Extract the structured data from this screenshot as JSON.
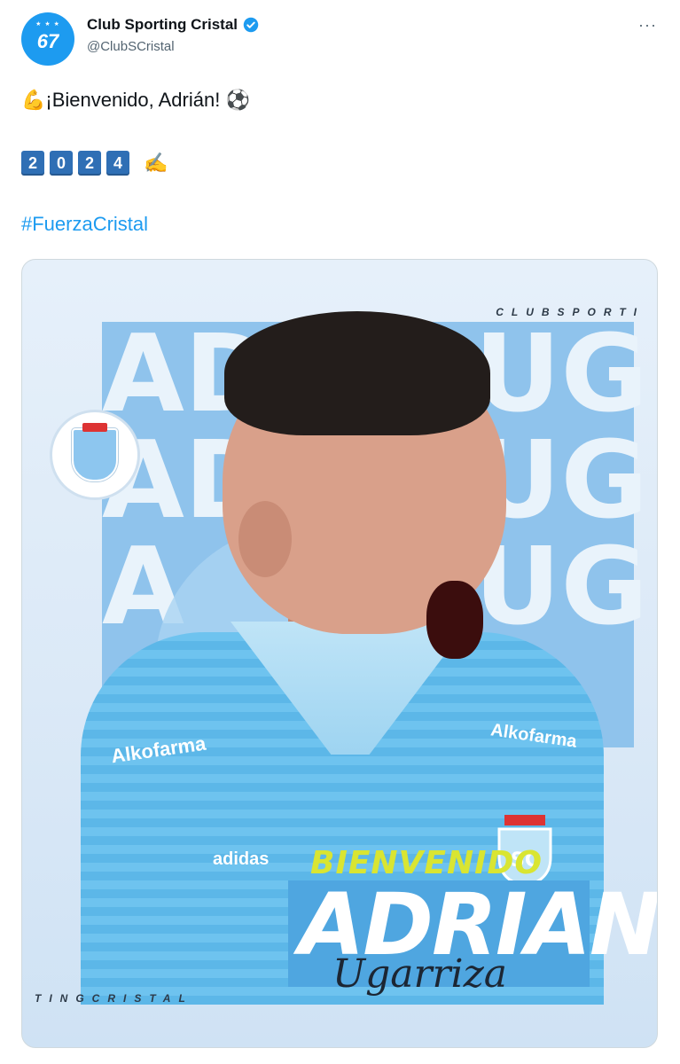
{
  "account": {
    "avatar_text": "67",
    "avatar_stars": "★ ★ ★",
    "display_name": "Club Sporting Cristal",
    "handle": "@ClubSCristal",
    "more_label": "···"
  },
  "tweet": {
    "line1_emoji_start": "💪",
    "line1_text": "¡Bienvenido, Adrián!",
    "line1_emoji_end": "⚽",
    "year_digits": [
      "2",
      "0",
      "2",
      "4"
    ],
    "year_emoji": "✍",
    "hashtag": "#FuerzaCristal"
  },
  "image": {
    "top_caption": "CLUBSPORTI",
    "bottom_caption": "TINGCRISTAL",
    "background_letters": [
      "AD",
      "UG",
      "AD",
      "UG",
      "A",
      "UG"
    ],
    "sponsor": "Alkofarma",
    "kit_brand": "adidas",
    "welcome_text": "BIENVENIDO",
    "first_name": "ADRIAN",
    "last_name": "Ugarriza"
  },
  "colors": {
    "accent": "#1d9bf0",
    "key_blue": "#2f6fb5",
    "jersey": "#6ec3ef",
    "welcome_yellow": "#d9e532"
  }
}
